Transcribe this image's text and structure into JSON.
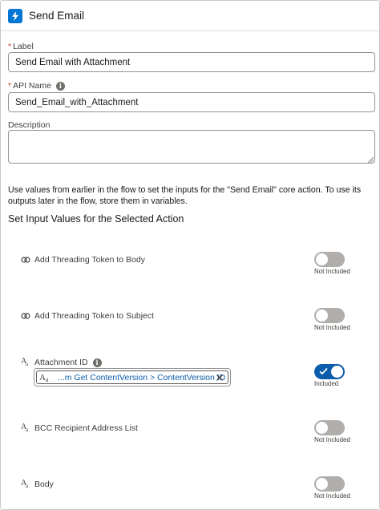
{
  "header": {
    "title": "Send Email",
    "icon": "lightning-bolt-icon",
    "icon_color": "#0176d3"
  },
  "form": {
    "label_field": {
      "label": "Label",
      "value": "Send Email with Attachment"
    },
    "api_name_field": {
      "label": "API Name",
      "value": "Send_Email_with_Attachment"
    },
    "description_field": {
      "label": "Description",
      "value": ""
    }
  },
  "help_text": "Use values from earlier in the flow to set the inputs for the \"Send Email\" core action. To use its outputs later in the flow, store them in variables.",
  "section_title": "Set Input Values for the Selected Action",
  "params": [
    {
      "label": "Add Threading Token to Body",
      "type_icon": "boolean-icon",
      "included": false,
      "caption": "Not Included"
    },
    {
      "label": "Add Threading Token to Subject",
      "type_icon": "boolean-icon",
      "included": false,
      "caption": "Not Included"
    },
    {
      "label": "Attachment ID",
      "type_icon": "text-type-icon",
      "included": true,
      "caption": "Included",
      "pill_value": "...m Get ContentVersion > ContentVersion ID"
    },
    {
      "label": "BCC Recipient Address List",
      "type_icon": "text-type-icon",
      "included": false,
      "caption": "Not Included"
    },
    {
      "label": "Body",
      "type_icon": "text-type-icon",
      "included": false,
      "caption": "Not Included"
    }
  ],
  "colors": {
    "toggle_on": "#0b5cab",
    "toggle_off": "#b0adab",
    "required": "#c23934"
  }
}
